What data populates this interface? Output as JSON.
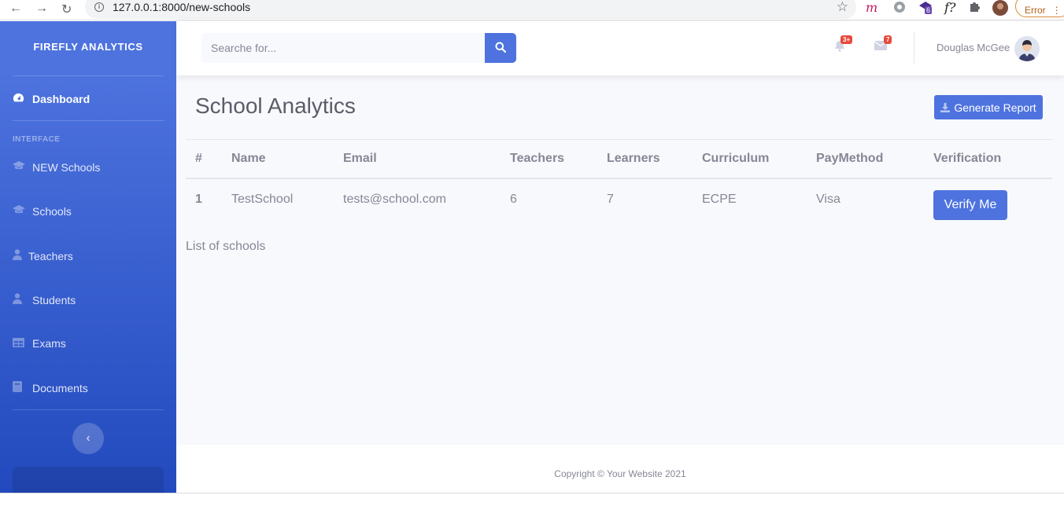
{
  "browser": {
    "url": "127.0.0.1:8000/new-schools",
    "error_label": "Error",
    "ext_badge": "6"
  },
  "sidebar": {
    "brand": "FIREFLY ANALYTICS",
    "dashboard_label": "Dashboard",
    "section_heading": "INTERFACE",
    "items": [
      {
        "label": "NEW Schools",
        "icon": "graduation-cap-icon"
      },
      {
        "label": "Schools",
        "icon": "graduation-cap-icon"
      },
      {
        "label": "Teachers",
        "icon": "user-tie-icon"
      },
      {
        "label": "Students",
        "icon": "user-icon"
      },
      {
        "label": "Exams",
        "icon": "table-icon"
      },
      {
        "label": "Documents",
        "icon": "book-icon"
      }
    ]
  },
  "topbar": {
    "search_placeholder": "Searche for...",
    "alerts_badge": "3+",
    "messages_badge": "7",
    "user_name": "Douglas McGee"
  },
  "main": {
    "title": "School Analytics",
    "generate_report_label": "Generate Report",
    "table": {
      "headers": [
        "#",
        "Name",
        "Email",
        "Teachers",
        "Learners",
        "Curriculum",
        "PayMethod",
        "Verification"
      ],
      "rows": [
        {
          "num": "1",
          "name": "TestSchool",
          "email": "tests@school.com",
          "teachers": "6",
          "learners": "7",
          "curriculum": "ECPE",
          "paymethod": "Visa",
          "action": "Verify Me"
        }
      ],
      "caption": "List of schools"
    }
  },
  "footer": {
    "copyright": "Copyright © Your Website 2021"
  },
  "colors": {
    "primary": "#4e73df",
    "sidebar_dark": "#224abe",
    "danger": "#e74a3b",
    "text": "#858796"
  }
}
